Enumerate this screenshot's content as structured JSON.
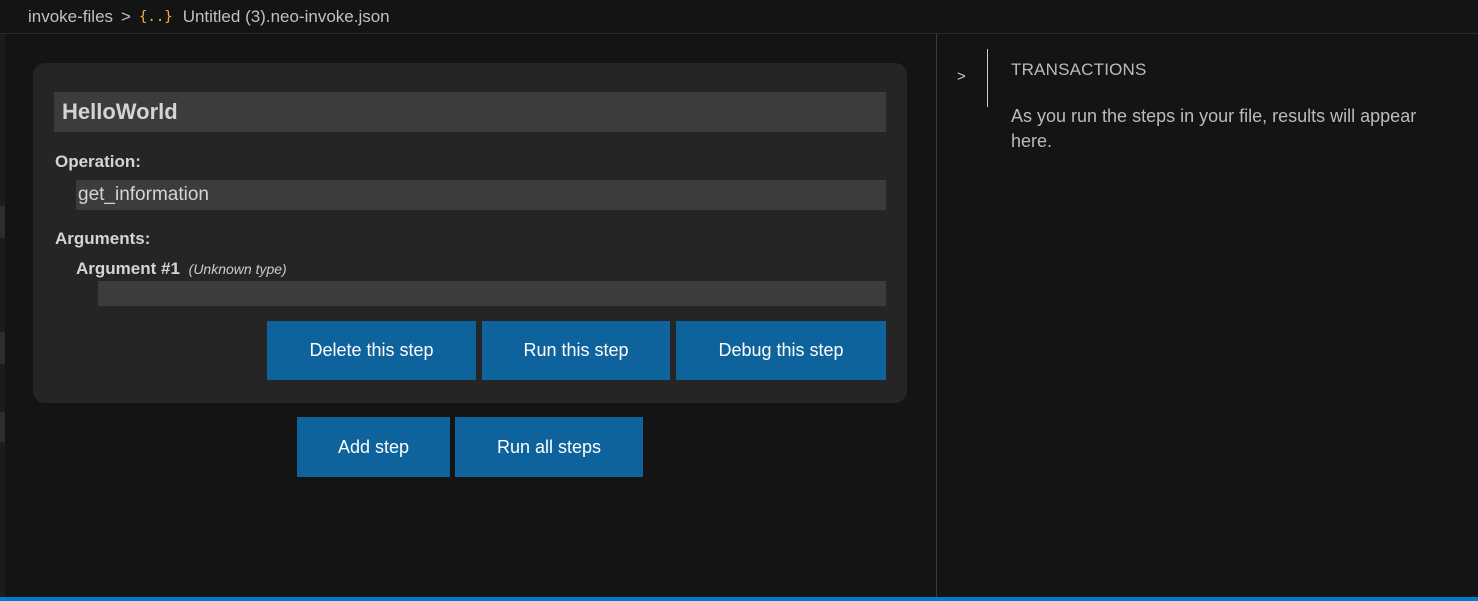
{
  "breadcrumb": {
    "folder": "invoke-files",
    "separator": ">",
    "file_icon": "{..}",
    "file_icon_name": "json-file-icon",
    "file_name": "Untitled (3).neo-invoke.json"
  },
  "step": {
    "name": "HelloWorld",
    "operation_label": "Operation:",
    "operation_value": "get_information",
    "arguments_label": "Arguments:",
    "argument": {
      "label": "Argument #1",
      "type": "(Unknown type)",
      "value": ""
    },
    "buttons": {
      "delete": "Delete this step",
      "run": "Run this step",
      "debug": "Debug this step"
    }
  },
  "actions": {
    "add_step": "Add step",
    "run_all": "Run all steps"
  },
  "transactions": {
    "chevron": ">",
    "title": "TRANSACTIONS",
    "message": "As you run the steps in your file, results will appear here."
  },
  "colors": {
    "button": "#0e639c",
    "status_bar": "#007acc",
    "json_icon": "#e8b53e"
  }
}
